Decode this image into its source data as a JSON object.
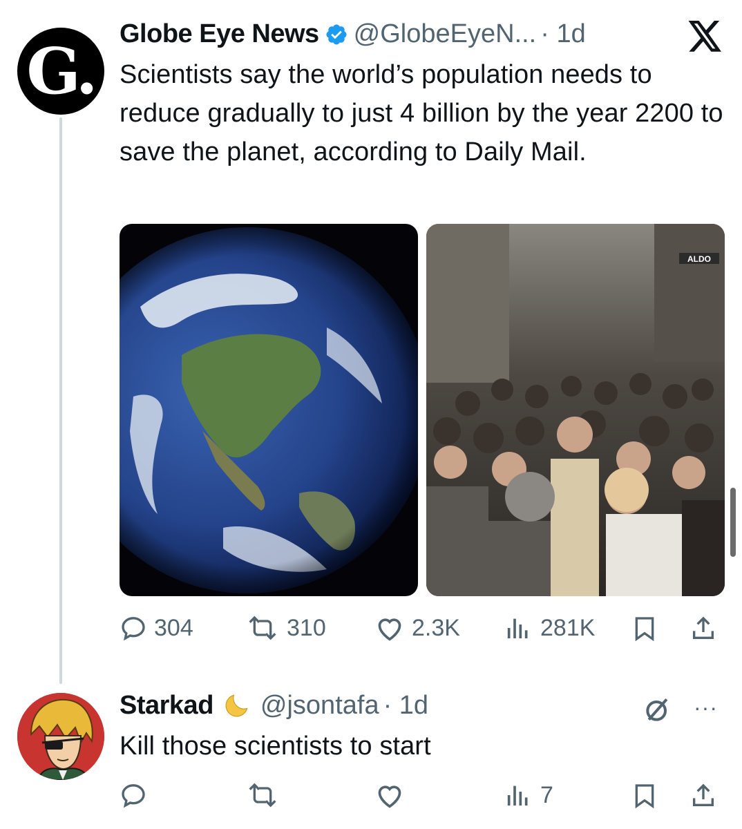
{
  "tweet": {
    "author_name": "Globe Eye News",
    "handle": "@GlobeEyeN...",
    "time": "· 1d",
    "avatar_letter": "G.",
    "text": "Scientists say the world’s population needs to reduce gradually to just 4 billion by the year 2200 to save the planet, according to Daily Mail.",
    "media": [
      {
        "name": "earth-image",
        "store_sign": ""
      },
      {
        "name": "crowd-image",
        "store_sign": "ALDO"
      }
    ],
    "actions": {
      "replies": "304",
      "reposts": "310",
      "likes": "2.3K",
      "views": "281K"
    }
  },
  "reply": {
    "author_name": "Starkad",
    "handle": "@jsontafa",
    "time": "· 1d",
    "text": "Kill those scientists to start",
    "more_label": "···",
    "actions": {
      "replies": "",
      "reposts": "",
      "likes": "",
      "views": "7"
    }
  },
  "colors": {
    "text": "#0f1419",
    "secondary": "#536471",
    "verified": "#1d9bf0",
    "line": "#cfd9de"
  }
}
